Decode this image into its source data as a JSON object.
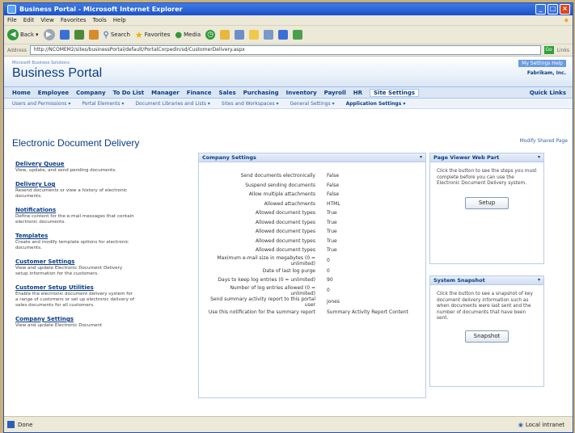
{
  "window": {
    "title": "Business Portal - Microsoft Internet Explorer"
  },
  "menu": [
    "File",
    "Edit",
    "View",
    "Favorites",
    "Tools",
    "Help"
  ],
  "toolbar": {
    "back": "Back",
    "search": "Search",
    "favorites": "Favorites",
    "media": "Media"
  },
  "address": {
    "label": "Address",
    "url": "http://NCOMEM2/sites/businessPortal/default/PortalCorpedin/sd/CustomerDelivery.aspx",
    "go": "Go",
    "links": "Links"
  },
  "portal": {
    "small_text": "Microsoft Business Solutions",
    "brand": "Business Portal",
    "top_links": "My Settings   Help",
    "welcome": "Fabrikam, Inc."
  },
  "topnav": [
    "Home",
    "Employee",
    "Company",
    "To Do List",
    "Manager",
    "Finance",
    "Sales",
    "Purchasing",
    "Inventory",
    "Payroll",
    "HR",
    "Site Settings",
    "Quick Links"
  ],
  "subnav": [
    "Users and Permissions",
    "Portal Elements",
    "Document Libraries and Lists",
    "Sites and Workspaces",
    "General Settings",
    "Application Settings"
  ],
  "page": {
    "title": "Electronic Document Delivery",
    "modify_link": "Modify Shared Page"
  },
  "leftnav": [
    {
      "title": "Delivery Queue",
      "desc": "View, update, and send pending documents."
    },
    {
      "title": "Delivery Log",
      "desc": "Resend documents or view a history of electronic documents."
    },
    {
      "title": "Notifications",
      "desc": "Define content for the e-mail messages that contain electronic documents."
    },
    {
      "title": "Templates",
      "desc": "Create and modify template options for electronic documents."
    },
    {
      "title": "Customer Settings",
      "desc": "View and update Electronic Document Delivery setup information for the customers."
    },
    {
      "title": "Customer Setup Utilities",
      "desc": "Enable the electronic document delivery system for a range of customers or set up electronic delivery of sales documents for all customers."
    },
    {
      "title": "Company Settings",
      "desc": "View and update Electronic Document"
    }
  ],
  "company_settings": {
    "title": "Company Settings",
    "rows": [
      {
        "label": "Send documents electronically",
        "value": "False"
      },
      {
        "label": "Suspend sending documents",
        "value": "False"
      },
      {
        "label": "Allow multiple attachments",
        "value": "False"
      },
      {
        "label": "Allowed attachments",
        "value": "HTML"
      },
      {
        "label": "Allowed document types",
        "value": "True"
      },
      {
        "label": "Allowed document types",
        "value": "True"
      },
      {
        "label": "Allowed document types",
        "value": "True"
      },
      {
        "label": "Allowed document types",
        "value": "True"
      },
      {
        "label": "Allowed document types",
        "value": "True"
      },
      {
        "label": "Maximum e-mail size in megabytes (0 = unlimited)",
        "value": "0"
      },
      {
        "label": "Date of last log purge",
        "value": "0"
      },
      {
        "label": "Days to keep log entries (0 = unlimited)",
        "value": "90"
      },
      {
        "label": "Number of log entries allowed (0 = unlimited)",
        "value": "0"
      },
      {
        "label": "Send summary activity report to this portal user",
        "value": "jones"
      },
      {
        "label": "Use this notification for the summary report",
        "value": "Summary Activity Report Content"
      }
    ]
  },
  "page_viewer": {
    "title": "Page Viewer Web Part",
    "body": "Click the button to see the steps you must complete before you can use the Electronic Document Delivery system.",
    "button": "Setup"
  },
  "system_snapshot": {
    "title": "System Snapshot",
    "body": "Click the button to see a snapshot of key document delivery information such as when documents were last sent and the number of documents that have been sent.",
    "button": "Snapshot"
  },
  "status": {
    "left": "Done",
    "zone": "Local intranet"
  }
}
